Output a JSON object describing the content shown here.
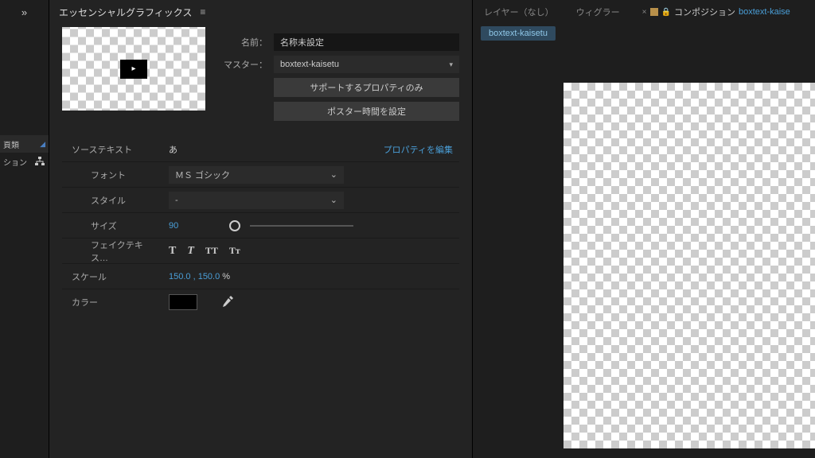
{
  "leftStrip": {
    "expandGlyph": "»",
    "tab1": "頁類",
    "tab2": "ション"
  },
  "panel": {
    "title": "エッセンシャルグラフィックス",
    "menuGlyph": "≡"
  },
  "header": {
    "nameLabel": "名前：",
    "nameValue": "名称未設定",
    "masterLabel": "マスター：",
    "masterValue": "boxtext-kaisetu",
    "btnSupported": "サポートするプロパティのみ",
    "btnPoster": "ポスター時間を設定"
  },
  "props": {
    "sourceTextLabel": "ソーステキスト",
    "sourceTextValue": "あ",
    "editLink": "プロパティを編集",
    "fontLabel": "フォント",
    "fontValue": "ＭＳ ゴシック",
    "styleLabel": "スタイル",
    "styleValue": "-",
    "sizeLabel": "サイズ",
    "sizeValue": "90",
    "fakeLabel": "フェイクテキス…",
    "scaleLabel": "スケール",
    "scaleValue": "150.0 , 150.0",
    "scaleUnit": " %",
    "colorLabel": "カラー",
    "colorHex": "#000000"
  },
  "fakeButtons": {
    "b1": "T",
    "b2": "T",
    "b3": "TT",
    "b4": "Tᴛ"
  },
  "rightTabs": {
    "layer": "レイヤー（なし）",
    "wiggler": "ウィグラー",
    "compLabel": "コンポジション",
    "compName": "boxtext-kaise",
    "subChip": "boxtext-kaisetu"
  }
}
